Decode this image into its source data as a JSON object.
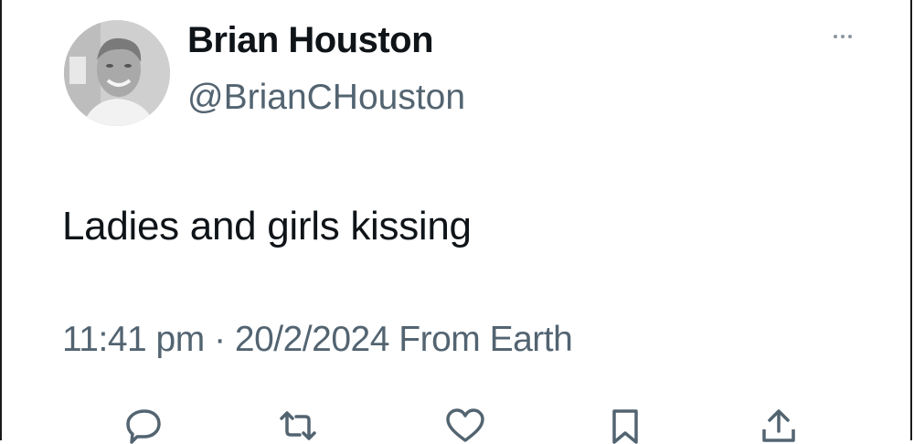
{
  "author": {
    "display_name": "Brian Houston",
    "handle": "@BrianCHouston",
    "avatar": "profile-photo"
  },
  "tweet": {
    "text": "Ladies and girls kissing",
    "time": "11:41 pm",
    "separator": "·",
    "date": "20/2/2024",
    "source": "From Earth"
  },
  "icons": {
    "more": "more-options-icon",
    "reply": "reply-icon",
    "retweet": "retweet-icon",
    "like": "like-icon",
    "bookmark": "bookmark-icon",
    "share": "share-icon"
  },
  "colors": {
    "text": "#0f1419",
    "secondary": "#536471"
  }
}
